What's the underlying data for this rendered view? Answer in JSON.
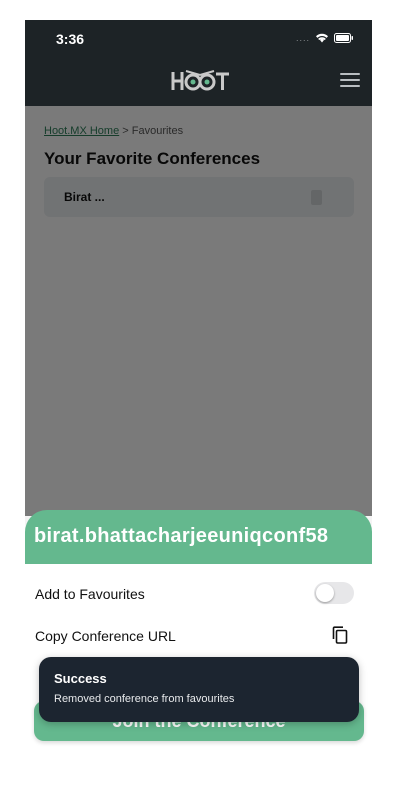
{
  "status_bar": {
    "time": "3:36",
    "signal": "....",
    "wifi_icon": "wifi-icon",
    "battery_icon": "battery-icon"
  },
  "navbar": {
    "logo_text": "HOOT",
    "menu_icon": "hamburger-menu-icon"
  },
  "page": {
    "breadcrumb": {
      "home_link": "Hoot.MX Home",
      "separator": " > ",
      "current": "Favourites"
    },
    "title": "Your Favorite Conferences",
    "conferences": [
      {
        "name": "Birat ..."
      }
    ]
  },
  "sheet": {
    "title": "birat.bhattacharjeeuniqconf58",
    "add_to_favourites_label": "Add to Favourites",
    "add_to_favourites_on": false,
    "copy_url_label": "Copy Conference URL",
    "join_button_label": "Join the Conference"
  },
  "toast": {
    "title": "Success",
    "message": "Removed conference from favourites"
  },
  "colors": {
    "accent": "#64b88e",
    "dark": "#1d2326",
    "toast_bg": "#1c2530"
  }
}
